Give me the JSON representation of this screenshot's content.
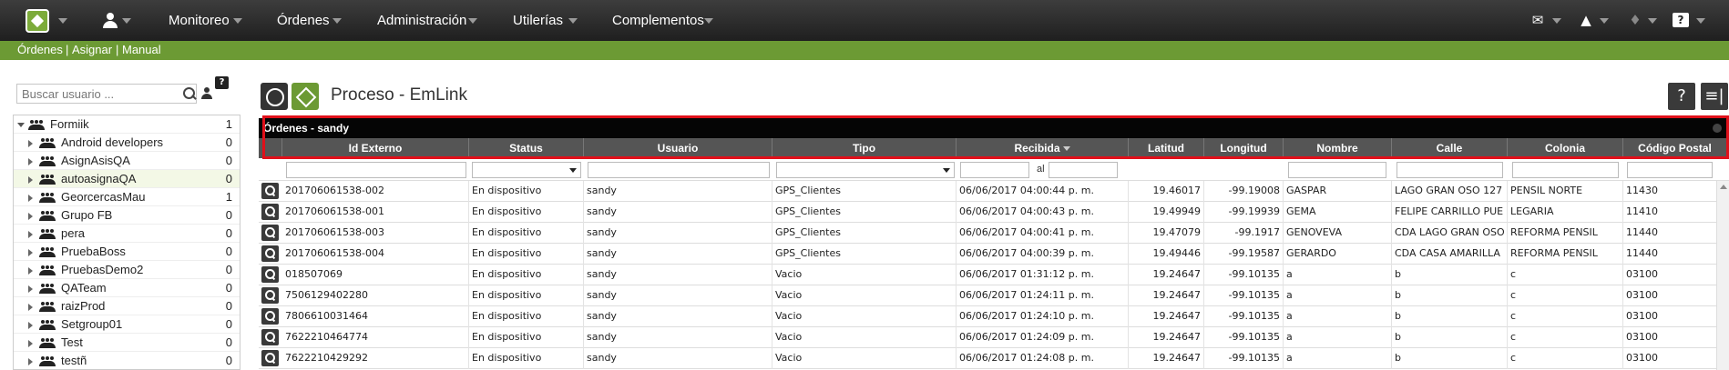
{
  "nav": {
    "items": [
      "Monitoreo",
      "Órdenes",
      "Administración",
      "Utilerías",
      "Complementos"
    ]
  },
  "subnav": {
    "links": [
      "Órdenes",
      "Asignar",
      "Manual"
    ]
  },
  "sidebar": {
    "search_placeholder": "Buscar usuario ...",
    "help_label": "?",
    "groups": [
      {
        "label": "Formiik",
        "count": "1"
      },
      {
        "label": "Android developers",
        "count": "0"
      },
      {
        "label": "AsignAsisQA",
        "count": "0"
      },
      {
        "label": "autoasignaQA",
        "count": "0"
      },
      {
        "label": "GeorcercasMau",
        "count": "1"
      },
      {
        "label": "Grupo FB",
        "count": "0"
      },
      {
        "label": "pera",
        "count": "0"
      },
      {
        "label": "PruebaBoss",
        "count": "0"
      },
      {
        "label": "PruebasDemo2",
        "count": "0"
      },
      {
        "label": "QATeam",
        "count": "0"
      },
      {
        "label": "raizProd",
        "count": "0"
      },
      {
        "label": "Setgroup01",
        "count": "0"
      },
      {
        "label": "Test",
        "count": "0"
      },
      {
        "label": "testñ",
        "count": "0"
      }
    ]
  },
  "main": {
    "title": "Proceso - EmLink",
    "help_label": "?",
    "menu_label": "≡|",
    "grid": {
      "caption": "Órdenes - sandy",
      "columns": [
        "Id Externo",
        "Status",
        "Usuario",
        "Tipo",
        "Recibida",
        "Latitud",
        "Longitud",
        "Nombre",
        "Calle",
        "Colonia",
        "Código Postal"
      ],
      "date_separator": "al",
      "rows": [
        [
          "201706061538-002",
          "En dispositivo",
          "sandy",
          "GPS_Clientes",
          "06/06/2017 04:00:44 p. m.",
          "19.46017",
          "-99.19008",
          "GASPAR",
          "LAGO GRAN OSO 127",
          "PENSIL NORTE",
          "11430"
        ],
        [
          "201706061538-001",
          "En dispositivo",
          "sandy",
          "GPS_Clientes",
          "06/06/2017 04:00:43 p. m.",
          "19.49949",
          "-99.19939",
          "GEMA",
          "FELIPE CARRILLO PUE",
          "LEGARIA",
          "11410"
        ],
        [
          "201706061538-003",
          "En dispositivo",
          "sandy",
          "GPS_Clientes",
          "06/06/2017 04:00:41 p. m.",
          "19.47079",
          "-99.1917",
          "GENOVEVA",
          "CDA LAGO GRAN OSO",
          "REFORMA PENSIL",
          "11440"
        ],
        [
          "201706061538-004",
          "En dispositivo",
          "sandy",
          "GPS_Clientes",
          "06/06/2017 04:00:39 p. m.",
          "19.49446",
          "-99.19587",
          "GERARDO",
          "CDA CASA AMARILLA",
          "REFORMA PENSIL",
          "11440"
        ],
        [
          "018507069",
          "En dispositivo",
          "sandy",
          "Vacio",
          "06/06/2017 01:31:12 p. m.",
          "19.24647",
          "-99.10135",
          "a",
          "b",
          "c",
          "03100"
        ],
        [
          "7506129402280",
          "En dispositivo",
          "sandy",
          "Vacio",
          "06/06/2017 01:24:11 p. m.",
          "19.24647",
          "-99.10135",
          "a",
          "b",
          "c",
          "03100"
        ],
        [
          "7806610031464",
          "En dispositivo",
          "sandy",
          "Vacio",
          "06/06/2017 01:24:10 p. m.",
          "19.24647",
          "-99.10135",
          "a",
          "b",
          "c",
          "03100"
        ],
        [
          "7622210464774",
          "En dispositivo",
          "sandy",
          "Vacio",
          "06/06/2017 01:24:09 p. m.",
          "19.24647",
          "-99.10135",
          "a",
          "b",
          "c",
          "03100"
        ],
        [
          "7622210429292",
          "En dispositivo",
          "sandy",
          "Vacio",
          "06/06/2017 01:24:08 p. m.",
          "19.24647",
          "-99.10135",
          "a",
          "b",
          "c",
          "03100"
        ]
      ]
    }
  },
  "icons": {
    "logo": "app-logo-icon",
    "user": "user-icon",
    "mail": "mail-icon",
    "alert": "alert-icon",
    "bell": "bell-icon",
    "help": "help-icon",
    "row_action": "magnifier-icon"
  },
  "colors": {
    "topbar": "#2b2b2b",
    "subbar": "#6c9a34",
    "highlight_frame": "#e0101a",
    "grid_header": "#555555"
  }
}
